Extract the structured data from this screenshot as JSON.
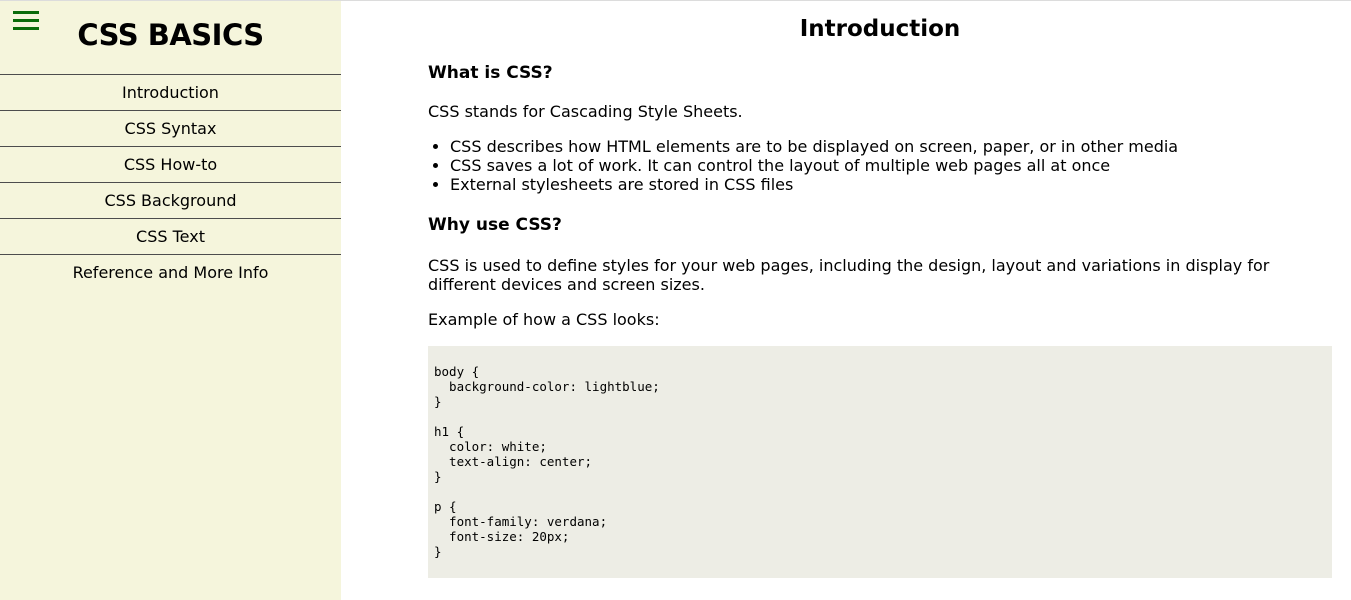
{
  "sidebar": {
    "brand": "CSS BASICS",
    "items": [
      {
        "label": "Introduction"
      },
      {
        "label": "CSS Syntax"
      },
      {
        "label": "CSS How-to"
      },
      {
        "label": "CSS Background"
      },
      {
        "label": "CSS Text"
      },
      {
        "label": "Reference and More Info"
      }
    ]
  },
  "main": {
    "title": "Introduction",
    "section1_heading": "What is CSS?",
    "section1_para": "CSS stands for Cascading Style Sheets.",
    "bullets": [
      "CSS describes how HTML elements are to be displayed on screen, paper, or in other media",
      "CSS saves a lot of work. It can control the layout of multiple web pages all at once",
      "External stylesheets are stored in CSS files"
    ],
    "section2_heading": "Why use CSS?",
    "section2_para": "CSS is used to define styles for your web pages, including the design, layout and variations in display for different devices and screen sizes.",
    "example_label": "Example of how a CSS looks:",
    "code": "body {\n  background-color: lightblue;\n}\n\nh1 {\n  color: white;\n  text-align: center;\n}\n\np {\n  font-family: verdana;\n  font-size: 20px;\n}"
  },
  "colors": {
    "sidebar_bg": "#f5f5dc",
    "hamburger": "#0a6b0a",
    "code_bg": "#ededE5"
  },
  "icons": {
    "menu": "hamburger-menu-icon"
  }
}
